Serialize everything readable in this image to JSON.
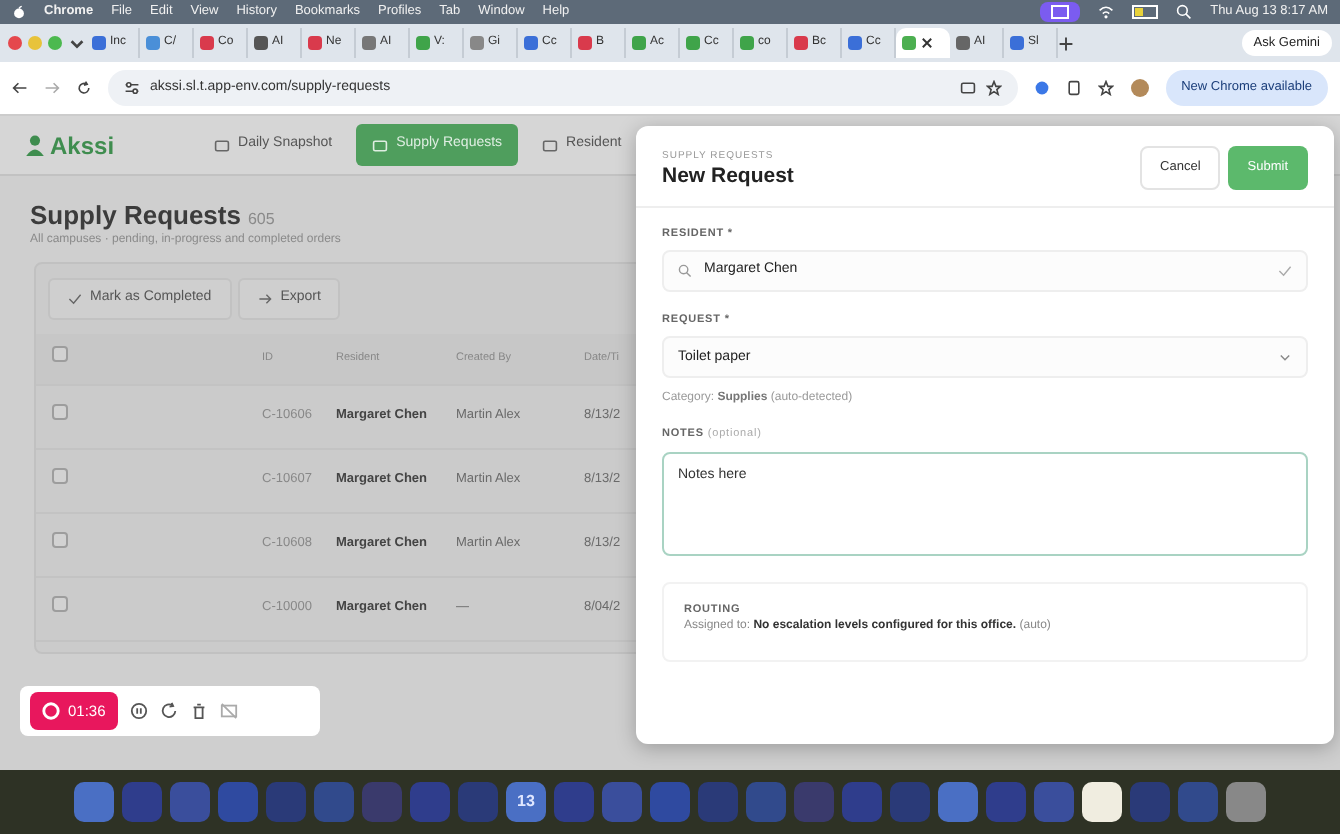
{
  "menu_bar": {
    "app": "Chrome",
    "items": [
      "File",
      "Edit",
      "View",
      "History",
      "Bookmarks",
      "Profiles",
      "Tab",
      "Window",
      "Help"
    ],
    "clock": "Thu Aug 13  8:17 AM"
  },
  "browser": {
    "tabs": [
      {
        "label": "Inc",
        "selected": false
      },
      {
        "label": "C/",
        "selected": false
      },
      {
        "label": "Co",
        "selected": false
      },
      {
        "label": "AI",
        "selected": false
      },
      {
        "label": "Ne",
        "selected": false
      },
      {
        "label": "AI",
        "selected": false
      },
      {
        "label": "V:",
        "selected": false
      },
      {
        "label": "Gi",
        "selected": false
      },
      {
        "label": "Cc",
        "selected": false
      },
      {
        "label": "B",
        "selected": false
      },
      {
        "label": "Ac",
        "selected": false
      },
      {
        "label": "Cc",
        "selected": false
      },
      {
        "label": "co",
        "selected": false
      },
      {
        "label": "Bc",
        "selected": false
      },
      {
        "label": "Cc",
        "selected": false
      },
      {
        "selected": true
      },
      {
        "label": "AI",
        "selected": false
      },
      {
        "label": "Sl",
        "selected": false
      }
    ],
    "ask_gemini": "Ask Gemini",
    "address": "akssi.sl.t.app-env.com/supply-requests",
    "update_button": "New Chrome available"
  },
  "app": {
    "logo": "Akssi",
    "nav": [
      {
        "label": "Daily Snapshot",
        "selected": false
      },
      {
        "label": "Supply Requests",
        "selected": true
      },
      {
        "label": "Resident",
        "selected": false
      }
    ],
    "title": "Supply Requests",
    "count": "605",
    "subtitle": "All campuses · pending, in-progress and completed orders",
    "actions": [
      "Mark as Completed",
      "Export"
    ],
    "table": {
      "select_all_checked": false,
      "columns": [
        "ID",
        "Resident",
        "Created By",
        "Date/Ti"
      ],
      "rows": [
        {
          "checked": false,
          "cells": [
            "C-10606",
            "Margaret Chen",
            "Martin Alex",
            "8/13/2"
          ]
        },
        {
          "checked": false,
          "cells": [
            "C-10607",
            "Margaret Chen",
            "Martin Alex",
            "8/13/2"
          ]
        },
        {
          "checked": false,
          "cells": [
            "C-10608",
            "Margaret Chen",
            "Martin Alex",
            "8/13/2"
          ]
        },
        {
          "checked": false,
          "cells": [
            "C-10000",
            "Margaret Chen",
            "—",
            "8/04/2"
          ]
        }
      ]
    }
  },
  "modal": {
    "eyebrow": "SUPPLY REQUESTS",
    "title": "New Request",
    "cancel": "Cancel",
    "submit": "Submit",
    "resident_label": "RESIDENT *",
    "resident_value": "Margaret Chen",
    "request_label": "REQUEST *",
    "request_value": "Toilet paper",
    "category": "Category: **Supplies** (auto-detected)",
    "notes_label": "NOTES",
    "notes_hint": "(optional)",
    "notes_value": "Notes here",
    "routing_label": "ROUTING",
    "routing_text": "Assigned to: **No escalation levels configured for this office.** (auto)"
  },
  "recorder": {
    "time": "01:36"
  },
  "dock": {
    "calendar_day": "13"
  }
}
